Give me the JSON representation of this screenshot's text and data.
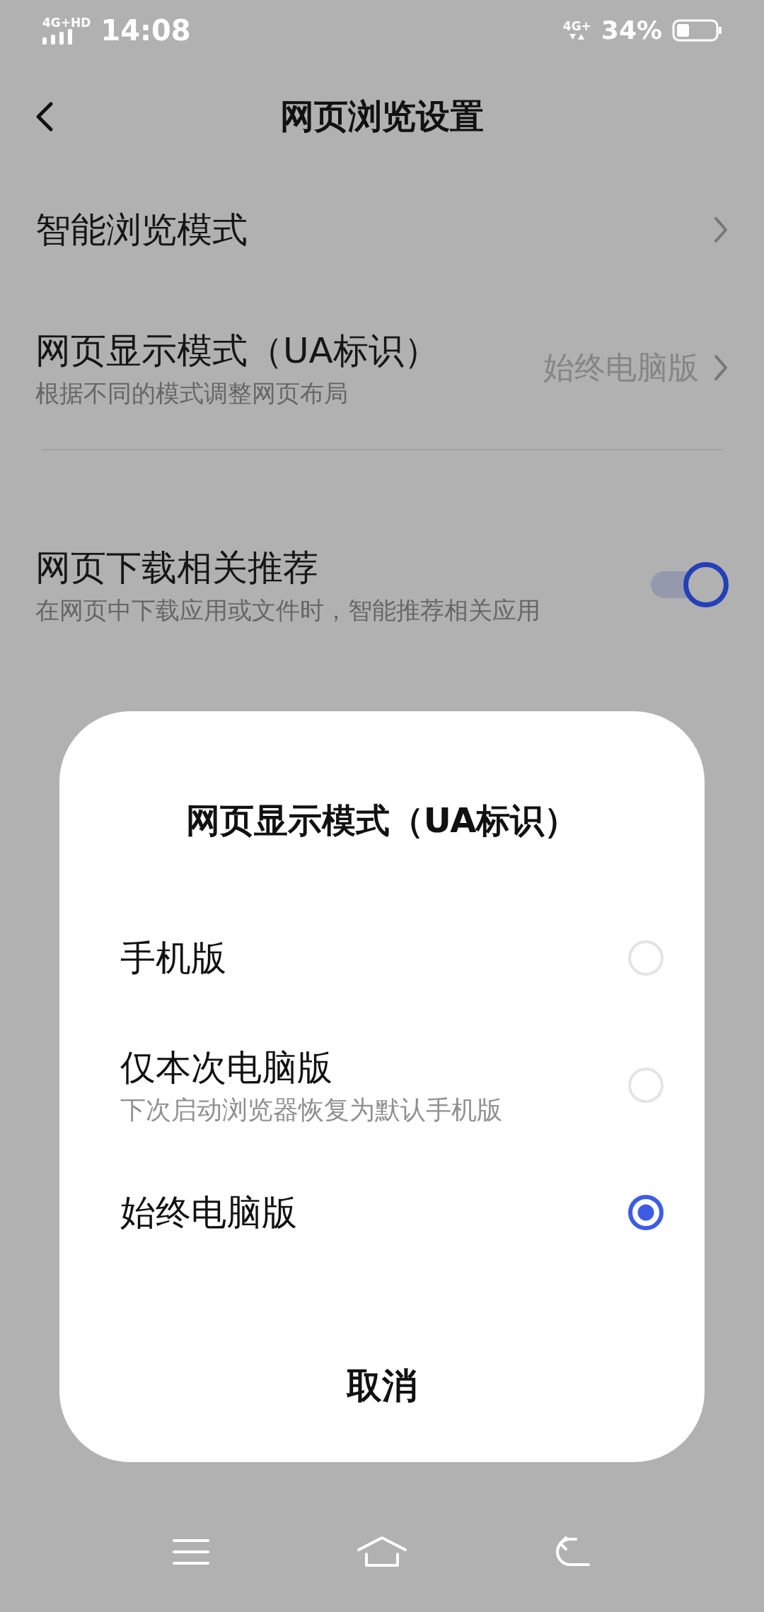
{
  "status_bar": {
    "network": "4G+HD",
    "time": "14:08",
    "data": "4G+",
    "battery": "34%"
  },
  "header": {
    "title": "网页浏览设置"
  },
  "sections": [
    {
      "items": [
        {
          "kind": "link",
          "title": "智能浏览模式"
        },
        {
          "kind": "link",
          "title": "网页显示模式（UA标识）",
          "subtitle": "根据不同的模式调整网页布局",
          "value": "始终电脑版"
        }
      ]
    },
    {
      "items": [
        {
          "kind": "toggle",
          "title": "网页下载相关推荐",
          "subtitle": "在网页中下载应用或文件时，智能推荐相关应用",
          "on": true
        }
      ]
    }
  ],
  "dialog": {
    "title": "网页显示模式（UA标识）",
    "options": [
      {
        "label": "手机版",
        "selected": false
      },
      {
        "label": "仅本次电脑版",
        "subtitle": "下次启动浏览器恢复为默认手机版",
        "selected": false
      },
      {
        "label": "始终电脑版",
        "selected": true
      }
    ],
    "cancel": "取消"
  }
}
